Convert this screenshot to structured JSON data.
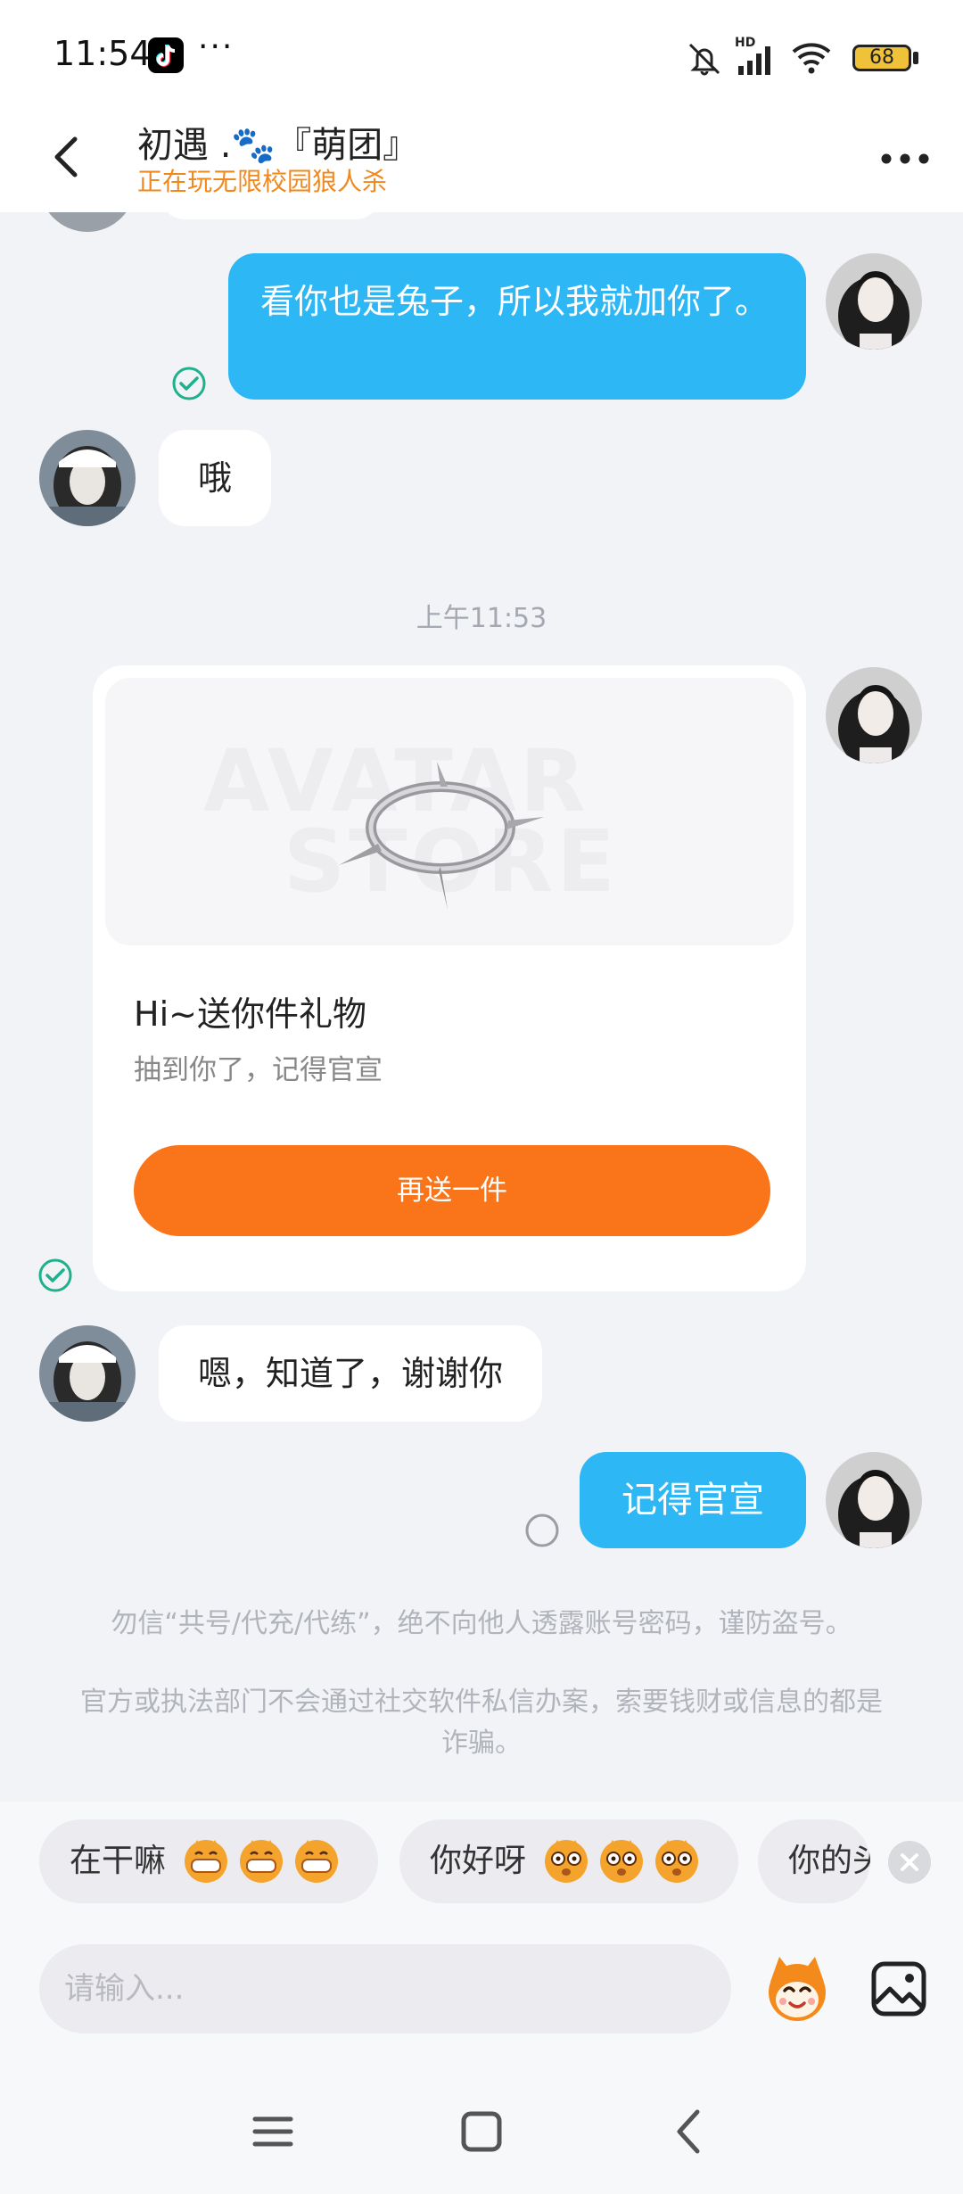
{
  "status_bar": {
    "time": "11:54",
    "more": "···",
    "battery": "68",
    "network_label": "HD"
  },
  "header": {
    "title": "初遇 .🐾『萌团』",
    "subtitle": "正在玩无限校园狼人杀"
  },
  "messages": {
    "m1_text": "看你也是兔子，所以我就加你了。",
    "m2_text": "哦",
    "timestamp": "上午11:53",
    "gift": {
      "title": "Hi~送你件礼物",
      "desc": "抽到你了，记得官宣",
      "button": "再送一件",
      "banner_word_1": "AVATAR",
      "banner_word_2": "STORE"
    },
    "m3_text": "嗯，知道了，谢谢你",
    "m4_text": "记得官宣"
  },
  "safety": {
    "line1": "勿信“共号/代充/代练”，绝不向他人透露账号密码，谨防盗号。",
    "line2": "官方或执法部门不会通过社交软件私信办案，索要钱财或信息的都是诈骗。"
  },
  "quick_replies": [
    {
      "label": "在干嘛"
    },
    {
      "label": "你好呀"
    },
    {
      "label": "你的头像"
    }
  ],
  "input": {
    "placeholder": "请输入..."
  },
  "colors": {
    "accent_blue": "#2db7f5",
    "gift_orange": "#fa7419",
    "subtitle_orange": "#f0891d",
    "check_green": "#1fb08c"
  }
}
